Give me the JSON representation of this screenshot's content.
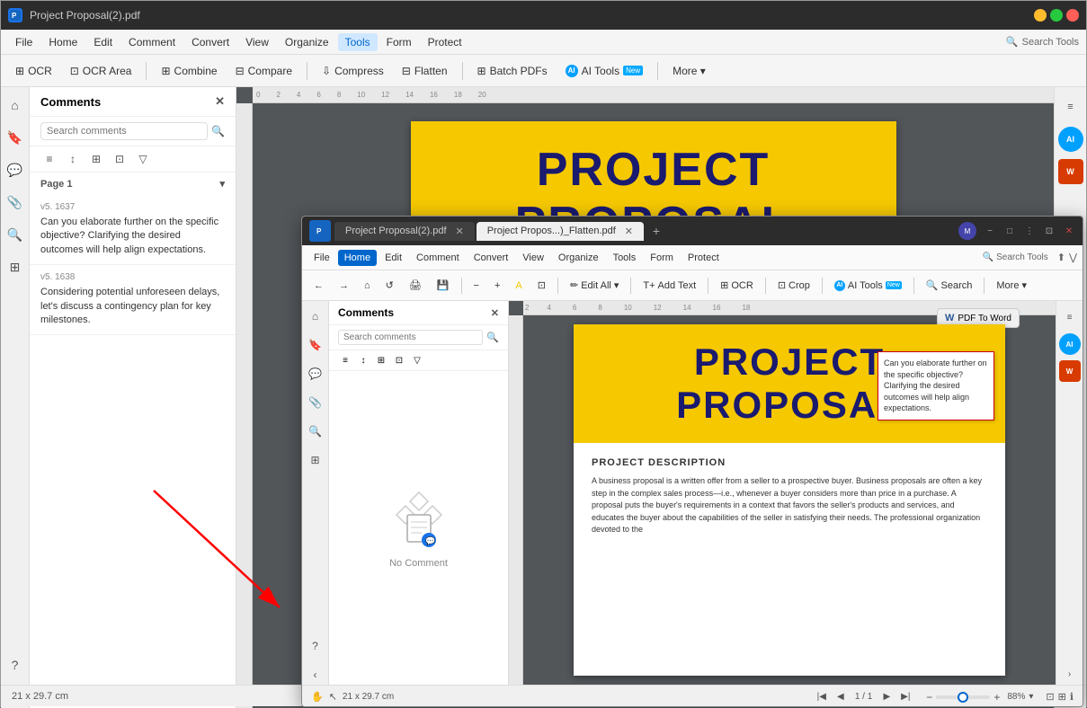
{
  "back_window": {
    "title": "Project Proposal(2).pdf",
    "title_icon": "P",
    "controls": [
      "close",
      "minimize",
      "maximize"
    ],
    "menu": {
      "items": [
        "File",
        "Home",
        "Edit",
        "Comment",
        "Convert",
        "View",
        "Organize",
        "Tools",
        "Form",
        "Protect"
      ],
      "active": "Tools"
    },
    "toolbar": {
      "items": [
        {
          "label": "OCR",
          "icon": "ocr"
        },
        {
          "label": "OCR Area",
          "icon": "ocr-area"
        },
        {
          "label": "Combine",
          "icon": "combine"
        },
        {
          "label": "Compare",
          "icon": "compare"
        },
        {
          "label": "Compress",
          "icon": "compress"
        },
        {
          "label": "Flatten",
          "icon": "flatten"
        },
        {
          "label": "Batch PDFs",
          "icon": "batch"
        },
        {
          "label": "AI Tools",
          "icon": "ai",
          "badge": "New"
        },
        {
          "label": "More",
          "icon": "more"
        }
      ]
    },
    "search_tools_placeholder": "Search Tools",
    "comments_panel": {
      "title": "Comments",
      "search_placeholder": "Search comments",
      "page_label": "Page 1",
      "comments": [
        {
          "id": "c1",
          "version": "v5. 1637",
          "text": "Can you elaborate further on the specific objective? Clarifying the desired outcomes will help align expectations."
        },
        {
          "id": "c2",
          "version": "v5. 1638",
          "text": "Considering potential unforeseen delays, let's discuss a contingency plan for key milestones."
        }
      ]
    },
    "pdf": {
      "title_line1": "PROJECT",
      "title_line2": "PROPOSAL"
    },
    "status": {
      "dimensions": "21 x 29.7 cm"
    }
  },
  "front_window": {
    "tabs": [
      {
        "label": "Project Proposal(2).pdf",
        "active": false,
        "closable": true
      },
      {
        "label": "Project Propos...)_Flatten.pdf",
        "active": true,
        "closable": true
      }
    ],
    "menu": {
      "items": [
        "File",
        "Home",
        "Edit",
        "Comment",
        "Convert",
        "View",
        "Organize",
        "Tools",
        "Form",
        "Protect"
      ],
      "active": "Home"
    },
    "toolbar": {
      "zoom_out": "−",
      "zoom_in": "+",
      "tools": [
        {
          "label": "Edit All",
          "icon": "edit"
        },
        {
          "label": "Add Text",
          "icon": "add-text"
        },
        {
          "label": "OCR",
          "icon": "ocr"
        },
        {
          "label": "Crop",
          "icon": "crop"
        },
        {
          "label": "AI Tools",
          "icon": "ai",
          "badge": "New"
        },
        {
          "label": "Search",
          "icon": "search"
        },
        {
          "label": "More",
          "icon": "more"
        }
      ]
    },
    "search_tools_placeholder": "Search Tools",
    "pdf_to_word": "PDF To Word",
    "comments_panel": {
      "title": "Comments",
      "search_placeholder": "Search comments",
      "no_comment_text": "No Comment"
    },
    "pdf": {
      "title_line1": "PROJECT",
      "title_line2": "PROPOSAL",
      "section_title": "PROJECT DESCRIPTION",
      "body_text": "A business proposal is a written offer from a seller to a prospective buyer. Business proposals are often a key step in the complex sales process—i.e., whenever a buyer considers more than price in a purchase. A proposal puts the buyer's requirements in a context that favors the seller's products and services, and educates the buyer about the capabilities of the seller in satisfying their needs. The professional organization devoted to the",
      "comment_popup": "Can you elaborate further on the specific objective? Clarifying the desired outcomes will help align expectations."
    },
    "status": {
      "dimensions": "21 x 29.7 cm",
      "page": "1 / 1",
      "zoom": "88%"
    }
  },
  "icons": {
    "close": "✕",
    "minimize": "−",
    "maximize": "□",
    "search": "🔍",
    "filter": "≡",
    "chevron_down": "▾",
    "chevron_right": "›",
    "more": "•••",
    "settings": "≡"
  }
}
